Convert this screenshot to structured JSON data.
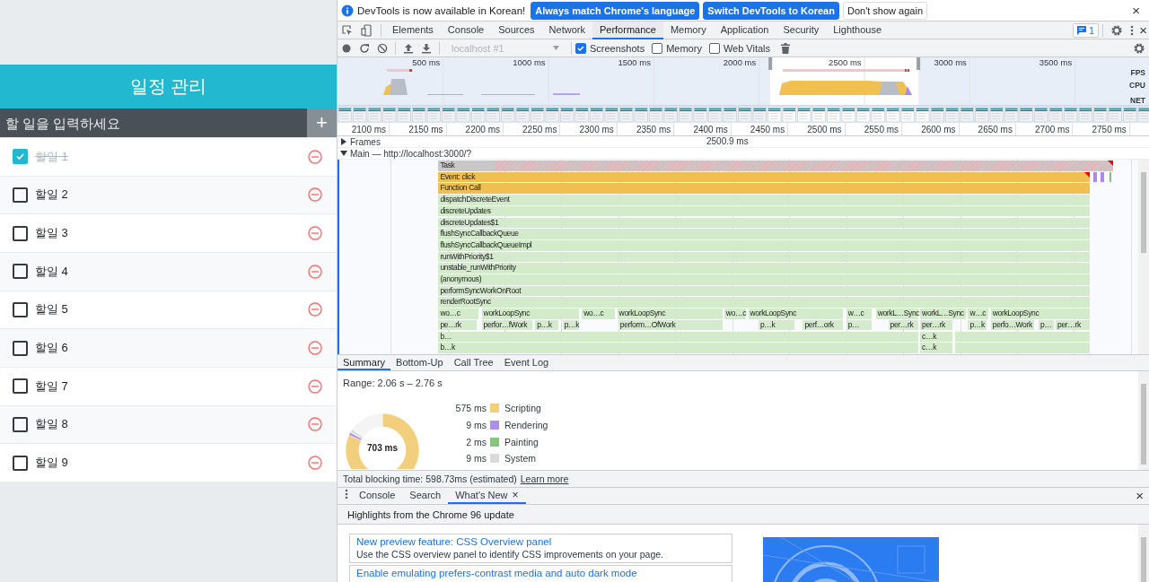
{
  "app": {
    "title": "일정 관리",
    "input": {
      "placeholder": "할 일을 입력하세요"
    },
    "add_button": "+",
    "todos": [
      {
        "text": "할일 1",
        "checked": true
      },
      {
        "text": "할일 2",
        "checked": false
      },
      {
        "text": "할일 3",
        "checked": false
      },
      {
        "text": "할일 4",
        "checked": false
      },
      {
        "text": "할일 5",
        "checked": false
      },
      {
        "text": "할일 6",
        "checked": false
      },
      {
        "text": "할일 7",
        "checked": false
      },
      {
        "text": "할일 8",
        "checked": false
      },
      {
        "text": "할일 9",
        "checked": false
      }
    ]
  },
  "devtools": {
    "infobar": {
      "message": "DevTools is now available in Korean!",
      "buttons": [
        {
          "label": "Always match Chrome's language",
          "kind": "primary"
        },
        {
          "label": "Switch DevTools to Korean",
          "kind": "primary"
        },
        {
          "label": "Don't show again",
          "kind": "secondary"
        }
      ],
      "close": "×"
    },
    "tabs": [
      {
        "label": "Elements",
        "selected": false
      },
      {
        "label": "Console",
        "selected": false
      },
      {
        "label": "Sources",
        "selected": false
      },
      {
        "label": "Network",
        "selected": false
      },
      {
        "label": "Performance",
        "selected": true
      },
      {
        "label": "Memory",
        "selected": false
      },
      {
        "label": "Application",
        "selected": false
      },
      {
        "label": "Security",
        "selected": false
      },
      {
        "label": "Lighthouse",
        "selected": false
      }
    ],
    "issues_count": "1",
    "close": "×",
    "toolbar": {
      "target": {
        "value": "localhost #1",
        "disabled": true
      },
      "options": [
        {
          "label": "Screenshots",
          "checked": true
        },
        {
          "label": "Memory",
          "checked": false
        },
        {
          "label": "Web Vitals",
          "checked": false
        }
      ]
    },
    "overview": {
      "ticks": [
        "500 ms",
        "1000 ms",
        "1500 ms",
        "2000 ms",
        "2500 ms",
        "3000 ms",
        "3500 ms"
      ],
      "tracks": [
        "FPS",
        "CPU",
        "NET"
      ]
    },
    "frames": {
      "label": "Frames",
      "expanded": false,
      "frame_time": "2500.9 ms"
    },
    "main": {
      "label": "Main — http://localhost:3000/?",
      "expanded": true
    },
    "flame_chart": {
      "ticks": [
        "2100 ms",
        "2150 ms",
        "2200 ms",
        "2250 ms",
        "2300 ms",
        "2350 ms",
        "2400 ms",
        "2450 ms",
        "2500 ms",
        "2550 ms",
        "2600 ms",
        "2650 ms",
        "2700 ms",
        "2750 ms"
      ],
      "rows": [
        {
          "blocks": [
            {
              "label": "Task",
              "kind": "task",
              "warning": true
            }
          ]
        },
        {
          "blocks": [
            {
              "label": "Event: click",
              "kind": "event",
              "warning": true
            },
            {
              "kind": "rendering",
              "warning": false
            },
            {
              "kind": "rendering",
              "warning": false
            },
            {
              "kind": "painting",
              "warning": false
            }
          ]
        },
        {
          "blocks": [
            {
              "label": "Function Call",
              "kind": "event",
              "warning": false
            }
          ]
        },
        {
          "blocks": [
            {
              "label": "dispatchDiscreteEvent",
              "kind": "js",
              "warning": false
            }
          ]
        },
        {
          "blocks": [
            {
              "label": "discreteUpdates",
              "kind": "js",
              "warning": false
            }
          ]
        },
        {
          "blocks": [
            {
              "label": "discreteUpdates$1",
              "kind": "js",
              "warning": false
            }
          ]
        },
        {
          "blocks": [
            {
              "label": "flushSyncCallbackQueue",
              "kind": "js",
              "warning": false
            }
          ]
        },
        {
          "blocks": [
            {
              "label": "flushSyncCallbackQueueImpl",
              "kind": "js",
              "warning": false
            }
          ]
        },
        {
          "blocks": [
            {
              "label": "runWithPriority$1",
              "kind": "js",
              "warning": false
            }
          ]
        },
        {
          "blocks": [
            {
              "label": "unstable_runWithPriority",
              "kind": "js",
              "warning": false
            }
          ]
        },
        {
          "blocks": [
            {
              "label": "(anonymous)",
              "kind": "js",
              "warning": false
            }
          ]
        },
        {
          "blocks": [
            {
              "label": "performSyncWorkOnRoot",
              "kind": "js",
              "warning": false
            }
          ]
        },
        {
          "blocks": [
            {
              "label": "renderRootSync",
              "kind": "js",
              "warning": false
            }
          ]
        },
        {
          "blocks": [
            {
              "label": "wo…c",
              "kind": "js",
              "warning": false
            },
            {
              "label": "workLoopSync",
              "kind": "js",
              "warning": false
            },
            {
              "label": "wo…c",
              "kind": "js",
              "warning": false
            },
            {
              "label": "workLoopSync",
              "kind": "js",
              "warning": false
            },
            {
              "label": "wo…c",
              "kind": "js",
              "warning": false
            },
            {
              "label": "workLoopSync",
              "kind": "js",
              "warning": false
            },
            {
              "label": "w…c",
              "kind": "js",
              "warning": false
            },
            {
              "label": "workL…Sync",
              "kind": "js",
              "warning": false
            },
            {
              "label": "workL…Sync",
              "kind": "js",
              "warning": false
            },
            {
              "label": "w…c",
              "kind": "js",
              "warning": false
            },
            {
              "label": "workLoopSync",
              "kind": "js",
              "warning": false
            }
          ]
        },
        {
          "blocks": [
            {
              "label": "pe…rk",
              "kind": "js",
              "warning": false
            },
            {
              "label": "perfor…fWork",
              "kind": "js",
              "warning": false
            },
            {
              "label": "p…k",
              "kind": "js",
              "warning": false
            },
            {
              "label": "p…k",
              "kind": "js",
              "warning": false
            },
            {
              "label": "perform…OfWork",
              "kind": "js",
              "warning": false
            },
            {
              "label": "p…k",
              "kind": "js",
              "warning": false
            },
            {
              "label": "perf…ork",
              "kind": "js",
              "warning": false
            },
            {
              "label": "p…",
              "kind": "js",
              "warning": false
            },
            {
              "label": "per…rk",
              "kind": "js",
              "warning": false
            },
            {
              "label": "per…rk",
              "kind": "js",
              "warning": false
            },
            {
              "label": "p…k",
              "kind": "js",
              "warning": false
            },
            {
              "label": "perfo…Work",
              "kind": "js",
              "warning": false
            },
            {
              "label": "p…",
              "kind": "js",
              "warning": false
            },
            {
              "label": "per…rk",
              "kind": "js",
              "warning": false
            }
          ]
        },
        {
          "blocks": [
            {
              "label": "b…",
              "kind": "js",
              "warning": false
            },
            {
              "label": "c…k",
              "kind": "js",
              "warning": false
            },
            {
              "kind": "js",
              "warning": false
            }
          ]
        },
        {
          "blocks": [
            {
              "label": "b…k",
              "kind": "js",
              "warning": false
            },
            {
              "label": "c…k",
              "kind": "js",
              "warning": false
            },
            {
              "kind": "js",
              "warning": false
            }
          ]
        }
      ]
    },
    "details_tabs": [
      {
        "label": "Summary",
        "selected": true
      },
      {
        "label": "Bottom-Up",
        "selected": false
      },
      {
        "label": "Call Tree",
        "selected": false
      },
      {
        "label": "Event Log",
        "selected": false
      }
    ],
    "summary": {
      "range": "Range: 2.06 s – 2.76 s",
      "total": "703 ms",
      "legend": [
        {
          "value": "575 ms",
          "label": "Scripting",
          "color": "#f2cf7c"
        },
        {
          "value": "9 ms",
          "label": "Rendering",
          "color": "#ab8fea"
        },
        {
          "value": "2 ms",
          "label": "Painting",
          "color": "#89c47f"
        },
        {
          "value": "9 ms",
          "label": "System",
          "color": "#dadada"
        }
      ]
    },
    "footer": {
      "text": "Total blocking time: 598.73ms (estimated)",
      "link": "Learn more"
    },
    "drawer": {
      "tabs": [
        {
          "label": "Console",
          "selected": false,
          "closable": false
        },
        {
          "label": "Search",
          "selected": false,
          "closable": false
        },
        {
          "label": "What's New",
          "selected": true,
          "closable": true
        }
      ],
      "tab_close": "×",
      "close": "×",
      "heading": "Highlights from the Chrome 96 update",
      "items": [
        {
          "title": "New preview feature: CSS Overview panel",
          "description": "Use the CSS overview panel to identify CSS improvements on your page."
        },
        {
          "title": "Enable emulating prefers-contrast media and auto dark mode"
        }
      ]
    }
  }
}
